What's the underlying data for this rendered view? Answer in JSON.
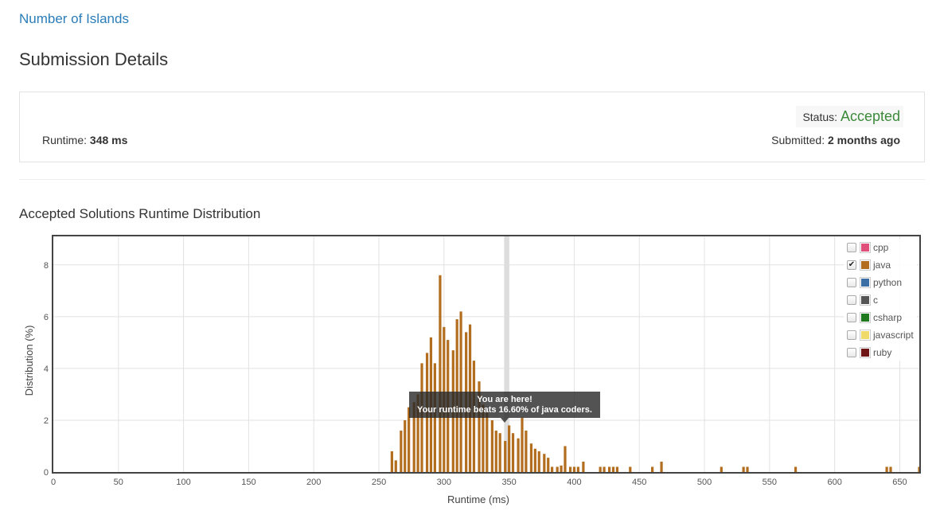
{
  "problem_link": "Number of Islands",
  "page_title": "Submission Details",
  "details": {
    "runtime_label": "Runtime:",
    "runtime_value": "348 ms",
    "status_label": "Status:",
    "status_value": "Accepted",
    "submitted_label": "Submitted:",
    "submitted_value": "2 months ago"
  },
  "section_title": "Accepted Solutions Runtime Distribution",
  "legend": [
    {
      "label": "cpp",
      "color": "#e0507a",
      "checked": false
    },
    {
      "label": "java",
      "color": "#b26d1e",
      "checked": true
    },
    {
      "label": "python",
      "color": "#3b6fa6",
      "checked": false
    },
    {
      "label": "c",
      "color": "#555555",
      "checked": false
    },
    {
      "label": "csharp",
      "color": "#1f7a1f",
      "checked": false
    },
    {
      "label": "javascript",
      "color": "#f0da6a",
      "checked": false
    },
    {
      "label": "ruby",
      "color": "#701515",
      "checked": false
    }
  ],
  "tooltip": {
    "line1": "You are here!",
    "line2": "Your runtime beats 16.60% of java coders."
  },
  "chart_data": {
    "type": "bar",
    "xlabel": "Runtime (ms)",
    "ylabel": "Distribution (%)",
    "xlim": [
      0,
      665
    ],
    "ylim": [
      0,
      9.1
    ],
    "x_ticks": [
      0,
      50,
      100,
      150,
      200,
      250,
      300,
      350,
      400,
      450,
      500,
      550,
      600,
      650
    ],
    "y_ticks": [
      0,
      2,
      4,
      6,
      8
    ],
    "highlight_x": 348,
    "bar_color": "#b26d1e",
    "x": [
      260,
      263,
      267,
      270,
      273,
      277,
      280,
      283,
      287,
      290,
      293,
      297,
      300,
      303,
      307,
      310,
      313,
      317,
      320,
      323,
      327,
      330,
      333,
      337,
      340,
      343,
      347,
      350,
      353,
      357,
      360,
      363,
      367,
      370,
      373,
      377,
      380,
      383,
      387,
      390,
      393,
      397,
      400,
      403,
      407,
      420,
      423,
      427,
      430,
      433,
      443,
      460,
      467,
      513,
      530,
      533,
      570,
      640,
      643,
      665
    ],
    "values": [
      0.8,
      0.45,
      1.6,
      2.0,
      2.5,
      2.7,
      3.0,
      4.2,
      4.6,
      5.2,
      4.2,
      7.6,
      5.6,
      5.1,
      4.7,
      5.9,
      6.2,
      5.4,
      5.7,
      4.3,
      3.5,
      2.6,
      2.3,
      2.0,
      1.6,
      1.5,
      1.2,
      1.8,
      1.5,
      1.3,
      2.1,
      1.6,
      1.1,
      0.9,
      0.8,
      0.7,
      0.55,
      0.2,
      0.2,
      0.25,
      1.0,
      0.2,
      0.2,
      0.2,
      0.4,
      0.2,
      0.2,
      0.2,
      0.2,
      0.2,
      0.2,
      0.2,
      0.4,
      0.2,
      0.2,
      0.2,
      0.2,
      0.2,
      0.2,
      0.2
    ]
  }
}
